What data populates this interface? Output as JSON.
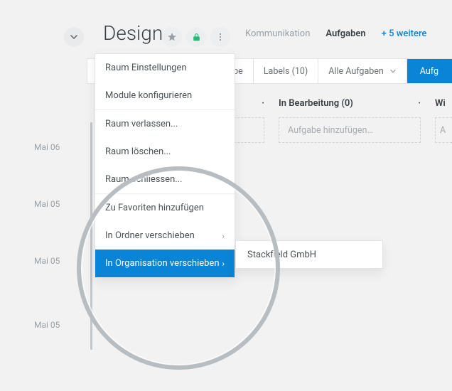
{
  "header": {
    "title": "Design",
    "tabs": {
      "communication": "Kommunikation",
      "tasks": "Aufgaben",
      "more": "+ 5 weitere"
    }
  },
  "filter": {
    "seg1": "Aufgabe",
    "seg2": "Labels (10)",
    "seg3": "Alle Aufgaben",
    "btn": "Aufg"
  },
  "columns": {
    "todo_label": "",
    "todo_dot": "·",
    "inprogress": "In Bearbeitung (0)",
    "inprogress_dot": "·",
    "last": "Wi",
    "addtask_placeholder": "Aufgabe hinzufügen…",
    "addtask_placeholder2": "A"
  },
  "dates": {
    "d1": "Mai 06",
    "d2": "Mai 05",
    "d3": "Mai 05",
    "d4": "Mai 05"
  },
  "menu": {
    "items": [
      "Raum Einstellungen",
      "Module konfigurieren",
      "Raum verlassen...",
      "Raum löschen...",
      "Raum schliessen...",
      "Zu Favoriten hinzufügen",
      "In Ordner verschieben",
      "In Organisation verschieben"
    ],
    "submenu_item": "Stackfield GmbH"
  }
}
